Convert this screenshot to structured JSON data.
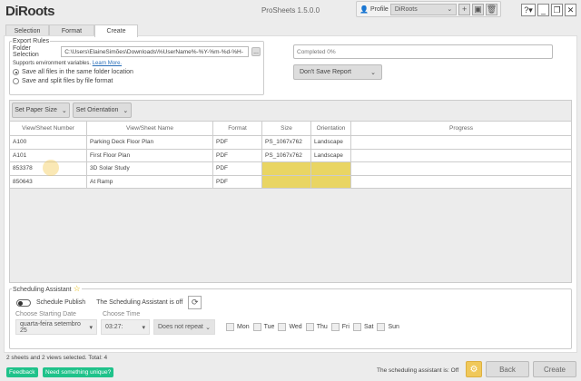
{
  "app": {
    "logo": "DiRoots",
    "title": "ProSheets 1.5.0.0"
  },
  "profile": {
    "label": "Profile",
    "value": "DiRoots"
  },
  "window": {
    "help": "?",
    "minimize": "_",
    "restore": "❐",
    "close": "✕"
  },
  "tabs": [
    {
      "label": "Selection"
    },
    {
      "label": "Format"
    },
    {
      "label": "Create"
    }
  ],
  "export_rules": {
    "legend": "Export Rules",
    "folder_label": "Folder Selection",
    "folder_value": "C:\\Users\\ElaineSimões\\Downloads\\%UserName%-%Y-%m-%d-%H-",
    "browse": "...",
    "hint": "Supports environment variables.",
    "learn_more": "Learn More.",
    "option1": "Save all files in the same folder location",
    "option2": "Save and split files by file format"
  },
  "progress": {
    "text": "Completed 0%",
    "value": 0
  },
  "report": {
    "value": "Don't Save Report"
  },
  "toolbar": {
    "paper_size": "Set Paper Size",
    "orientation": "Set Orientation"
  },
  "table": {
    "headers": [
      "View/Sheet Number",
      "View/Sheet Name",
      "Format",
      "Size",
      "Orientation",
      "Progress"
    ],
    "rows": [
      [
        "A100",
        "Parking Deck Floor Plan",
        "PDF",
        "PS_1067x762",
        "Landscape",
        ""
      ],
      [
        "A101",
        "First Floor Plan",
        "PDF",
        "PS_1067x762",
        "Landscape",
        ""
      ],
      [
        "853378",
        "3D Solar Study",
        "PDF",
        "",
        "",
        ""
      ],
      [
        "850643",
        "At Ramp",
        "PDF",
        "",
        "",
        ""
      ]
    ]
  },
  "scheduling": {
    "legend": "Scheduling Assistant",
    "toggle_label": "Schedule Publish",
    "status": "The Scheduling Assistant is off",
    "date_label": "Choose Starting Date",
    "date_value": "quarta-feira setembro 25",
    "time_label": "Choose Time",
    "time_value": "03:27:",
    "repeat": "Does not repeat",
    "days": [
      "Mon",
      "Tue",
      "Wed",
      "Thu",
      "Fri",
      "Sat",
      "Sun"
    ]
  },
  "footer": {
    "summary": "2 sheets and 2 views selected. Total: 4",
    "feedback": "Feedback",
    "unique": "Need something unique?",
    "assistant_status": "The scheduling assistant is: Off",
    "back": "Back",
    "create": "Create"
  }
}
